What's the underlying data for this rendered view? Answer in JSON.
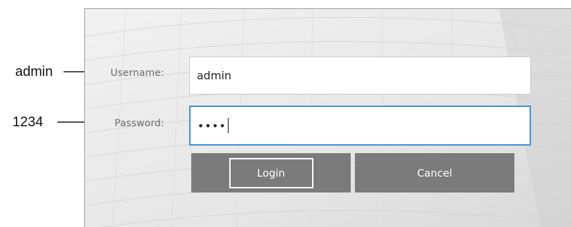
{
  "annotations": {
    "username_value": "admin",
    "password_value": "1234"
  },
  "form": {
    "username_label": "Username:",
    "username_value": "admin",
    "password_label": "Password:",
    "password_masked": "••••",
    "login_label": "Login",
    "cancel_label": "Cancel"
  },
  "colors": {
    "button_bg": "#7b7b7b",
    "focus_border": "#3d8fd6",
    "panel_bg": "#e9e9e9"
  }
}
